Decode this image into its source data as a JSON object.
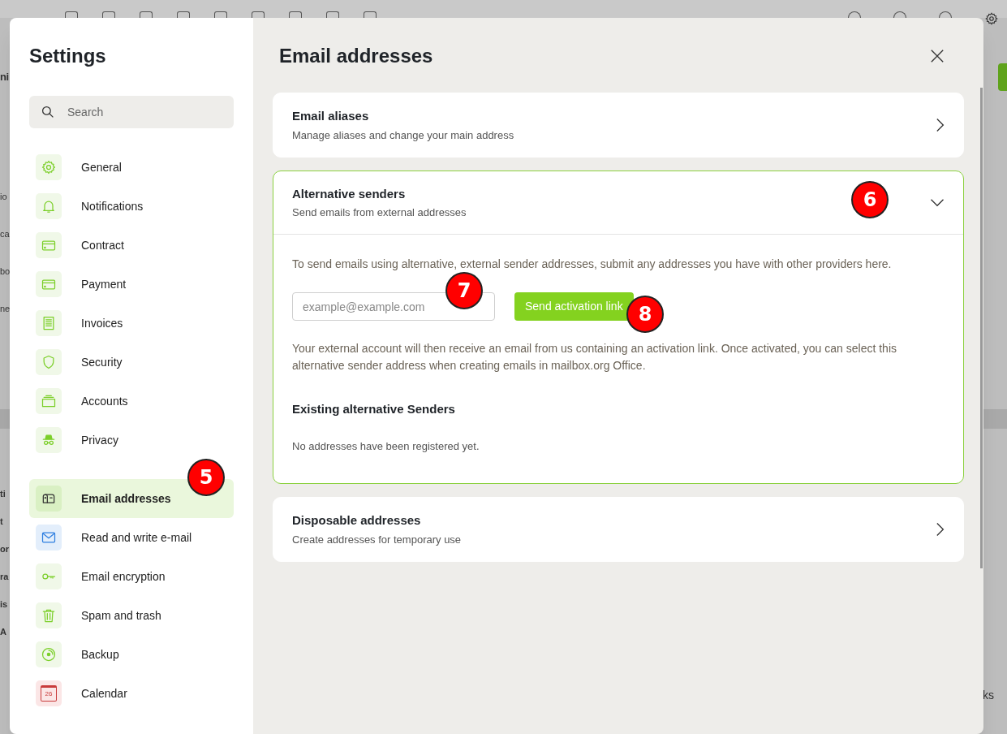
{
  "background": {
    "heading_fragment": "ni",
    "left_fragments": [
      "io",
      "ca",
      "bo",
      "ne"
    ],
    "bold_fragments": [
      "ti",
      "t",
      "or",
      "ra",
      "is",
      "A"
    ],
    "right_fragment": "ks"
  },
  "settings": {
    "title": "Settings",
    "search": {
      "placeholder": "Search"
    },
    "groups": [
      [
        {
          "label": "General",
          "kind": "gear",
          "selected": false
        },
        {
          "label": "Notifications",
          "kind": "bell",
          "selected": false
        },
        {
          "label": "Contract",
          "kind": "card",
          "selected": false
        },
        {
          "label": "Payment",
          "kind": "card",
          "selected": false
        },
        {
          "label": "Invoices",
          "kind": "receipt",
          "selected": false
        },
        {
          "label": "Security",
          "kind": "shield",
          "selected": false
        },
        {
          "label": "Accounts",
          "kind": "stack",
          "selected": false
        },
        {
          "label": "Privacy",
          "kind": "spy",
          "selected": false
        }
      ],
      [
        {
          "label": "Email addresses",
          "kind": "mailbox",
          "selected": true
        },
        {
          "label": "Read and write e-mail",
          "kind": "envelope",
          "selected": false
        },
        {
          "label": "Email encryption",
          "kind": "key",
          "selected": false
        },
        {
          "label": "Spam and trash",
          "kind": "trash",
          "selected": false
        },
        {
          "label": "Backup",
          "kind": "disc",
          "selected": false
        },
        {
          "label": "Calendar",
          "kind": "calendar",
          "selected": false,
          "day": "26"
        }
      ]
    ]
  },
  "content": {
    "title": "Email addresses",
    "sections": [
      {
        "title": "Email aliases",
        "subtitle": "Manage aliases and change your main address",
        "expanded": false
      },
      {
        "title": "Alternative senders",
        "subtitle": "Send emails from external addresses",
        "expanded": true,
        "intro": "To send emails using alternative, external sender addresses, submit any addresses you have with other providers here.",
        "email_field": {
          "placeholder": "example@example.com"
        },
        "button": "Send activation link",
        "note": "Your external account will then receive an email from us containing an activation link. Once activated, you can select this alternative sender address when creating emails in mailbox.org Office.",
        "list_title": "Existing alternative Senders",
        "empty": "No addresses have been registered yet."
      },
      {
        "title": "Disposable addresses",
        "subtitle": "Create addresses for temporary use",
        "expanded": false
      }
    ]
  },
  "markers": [
    "5",
    "6",
    "7",
    "8"
  ]
}
